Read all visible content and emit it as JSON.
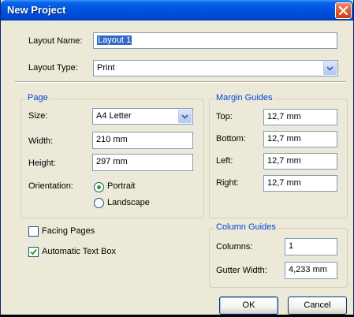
{
  "window": {
    "title": "New Project"
  },
  "layout": {
    "name_label": "Layout Name:",
    "name_value": "Layout 1",
    "type_label": "Layout Type:",
    "type_value": "Print"
  },
  "page": {
    "group_title": "Page",
    "size_label": "Size:",
    "size_value": "A4 Letter",
    "width_label": "Width:",
    "width_value": "210 mm",
    "height_label": "Height:",
    "height_value": "297 mm",
    "orientation_label": "Orientation:",
    "portrait_label": "Portrait",
    "landscape_label": "Landscape",
    "orientation_selected": "Portrait"
  },
  "margins": {
    "group_title": "Margin Guides",
    "top_label": "Top:",
    "top_value": "12,7 mm",
    "bottom_label": "Bottom:",
    "bottom_value": "12,7 mm",
    "left_label": "Left:",
    "left_value": "12,7 mm",
    "right_label": "Right:",
    "right_value": "12,7 mm"
  },
  "options": {
    "facing_pages_label": "Facing Pages",
    "facing_pages_checked": false,
    "auto_text_box_label": "Automatic Text Box",
    "auto_text_box_checked": true
  },
  "columns": {
    "group_title": "Column Guides",
    "columns_label": "Columns:",
    "columns_value": "1",
    "gutter_label": "Gutter Width:",
    "gutter_value": "4,233 mm"
  },
  "buttons": {
    "ok_label": "OK",
    "cancel_label": "Cancel"
  },
  "colors": {
    "titlebar": "#0054e3",
    "dialog_bg": "#ece9d8",
    "group_title": "#0046d5",
    "selection": "#316ac5",
    "close_button": "#e25a2f"
  }
}
